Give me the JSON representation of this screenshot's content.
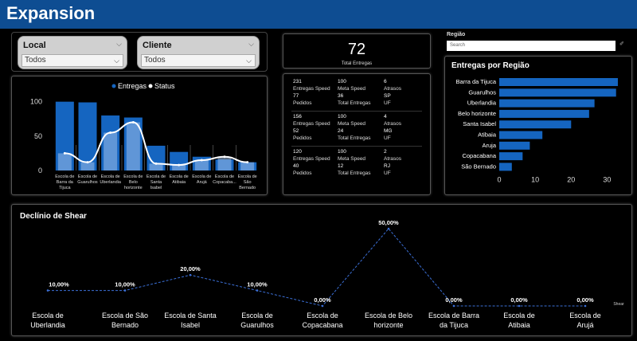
{
  "app": {
    "title": "Expansion"
  },
  "filters": {
    "local": {
      "label": "Local",
      "value": "Todos"
    },
    "cliente": {
      "label": "Cliente",
      "value": "Todos"
    }
  },
  "kpi": {
    "value": "72",
    "label": "Total Entregas"
  },
  "region_slicer": {
    "title": "Região",
    "placeholder": "Search"
  },
  "matrix": [
    {
      "entregas_speed": "231",
      "meta_speed": "100",
      "atrasos": "6",
      "pedidos": "77",
      "total_entregas": "36",
      "uf": "SP"
    },
    {
      "entregas_speed": "156",
      "meta_speed": "100",
      "atrasos": "4",
      "pedidos": "52",
      "total_entregas": "24",
      "uf": "MG"
    },
    {
      "entregas_speed": "120",
      "meta_speed": "100",
      "atrasos": "2",
      "pedidos": "40",
      "total_entregas": "12",
      "uf": "RJ"
    }
  ],
  "matrix_labels": {
    "entregas_speed": "Entregas Speed",
    "meta_speed": "Meta Speed",
    "atrasos": "Atrasos",
    "pedidos": "Pedidos",
    "total_entregas": "Total Entregas",
    "uf": "UF"
  },
  "chart_data": [
    {
      "type": "bar",
      "legend": [
        "Entregas",
        "Status"
      ],
      "categories": [
        "Escola de Barra da Tijuca",
        "Escola de Guarulhos",
        "Escola de Uberlandia",
        "Escola de Belo horizonte",
        "Escola de Santa Isabel",
        "Escola de Atibaia",
        "Escola de Arujá",
        "Escola de Copacaba...",
        "Escola de São Bernado"
      ],
      "series": [
        {
          "name": "Entregas",
          "values": [
            100,
            99,
            80,
            77,
            36,
            27,
            20,
            16,
            12
          ]
        },
        {
          "name": "Status",
          "values": [
            25,
            12,
            55,
            70,
            10,
            8,
            15,
            20,
            12
          ]
        }
      ],
      "yticks": [
        "0",
        "50",
        "100"
      ],
      "ylim": [
        0,
        110
      ],
      "colors": {
        "Entregas": "#1565c0",
        "Status": "#ffffff"
      }
    },
    {
      "type": "bar",
      "orientation": "horizontal",
      "title": "Entregas por Região",
      "categories": [
        "Barra da Tijuca",
        "Guarulhos",
        "Uberlandia",
        "Belo horizonte",
        "Santa Isabel",
        "Atibaia",
        "Aruja",
        "Copacabana",
        "São Bernado"
      ],
      "values": [
        33,
        32.5,
        26.5,
        25,
        20,
        12,
        8.5,
        6.5,
        3.5
      ],
      "xticks": [
        "0",
        "10",
        "20",
        "30"
      ],
      "xlim": [
        0,
        35
      ],
      "color": "#1565c0"
    },
    {
      "type": "line",
      "title": "Declínio de Shear",
      "legend": "Shear",
      "categories": [
        "Escola de Uberlandia",
        "Escola de São Bernado",
        "Escola de Santa Isabel",
        "Escola de Guarulhos",
        "Escola de Copacabana",
        "Escola de Belo horizonte",
        "Escola de Barra da Tijuca",
        "Escola de Atibaia",
        "Escola de Arujá"
      ],
      "values": [
        10,
        10,
        20,
        10,
        0,
        50,
        0,
        0,
        0
      ],
      "labels": [
        "10,00%",
        "10,00%",
        "20,00%",
        "10,00%",
        "0,00%",
        "50,00%",
        "0,00%",
        "0,00%",
        "0,00%"
      ],
      "ylim": [
        0,
        50
      ],
      "color": "#3b6fd6"
    }
  ]
}
